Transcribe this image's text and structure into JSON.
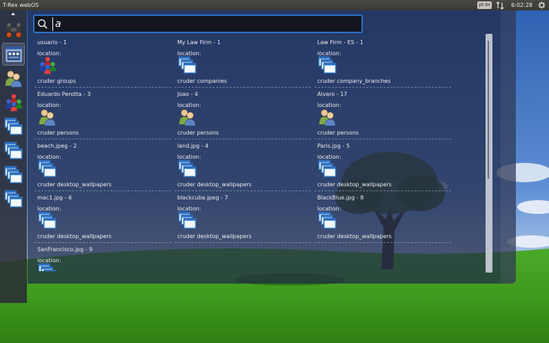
{
  "topbar": {
    "title": "T-Rex webOS",
    "language": "pt-br",
    "clock": "6:02:28"
  },
  "launcher": {
    "items": [
      {
        "name": "binoculars",
        "icon": "binoculars-icon",
        "active": false
      },
      {
        "name": "dash",
        "icon": "dash-window-icon",
        "active": true
      },
      {
        "name": "persons",
        "icon": "persons-icon",
        "active": false
      },
      {
        "name": "groups",
        "icon": "groups-icon",
        "active": false
      },
      {
        "name": "windows-1",
        "icon": "windows-icon",
        "active": false
      },
      {
        "name": "windows-2",
        "icon": "windows-icon",
        "active": false
      },
      {
        "name": "windows-3",
        "icon": "windows-icon",
        "active": false
      },
      {
        "name": "windows-4",
        "icon": "windows-icon",
        "active": false
      }
    ]
  },
  "search": {
    "value": "a",
    "placeholder": ""
  },
  "results": [
    {
      "title": "usuario - 1",
      "location_label": "location:",
      "type": "cruder groups",
      "icon": "groups-icon"
    },
    {
      "title": "My Law Firm - 1",
      "location_label": "location:",
      "type": "cruder companies",
      "icon": "windows-icon"
    },
    {
      "title": "Law Firm - ES - 1",
      "location_label": "location:",
      "type": "cruder company_branches",
      "icon": "windows-icon"
    },
    {
      "title": "Eduardo Perotta - 3",
      "location_label": "location:",
      "type": "cruder persons",
      "icon": "persons-icon"
    },
    {
      "title": "Joao - 4",
      "location_label": "location:",
      "type": "cruder persons",
      "icon": "persons-icon"
    },
    {
      "title": "Alvaro - 17",
      "location_label": "location:",
      "type": "cruder persons",
      "icon": "persons-icon"
    },
    {
      "title": "beach.jpeg - 2",
      "location_label": "location:",
      "type": "cruder desktop_wallpapers",
      "icon": "windows-icon"
    },
    {
      "title": "land.jpg - 4",
      "location_label": "location:",
      "type": "cruder desktop_wallpapers",
      "icon": "windows-icon"
    },
    {
      "title": "Paris.jpg - 5",
      "location_label": "location:",
      "type": "cruder desktop_wallpapers",
      "icon": "windows-icon"
    },
    {
      "title": "mac1.jpg - 6",
      "location_label": "location:",
      "type": "cruder desktop_wallpapers",
      "icon": "windows-icon"
    },
    {
      "title": "blackcube.jpeg - 7",
      "location_label": "location:",
      "type": "cruder desktop_wallpapers",
      "icon": "windows-icon"
    },
    {
      "title": "BlackBlue.jpg - 8",
      "location_label": "location:",
      "type": "cruder desktop_wallpapers",
      "icon": "windows-icon"
    },
    {
      "title": "SanFrancisco.jpg - 9",
      "location_label": "location:",
      "type": "",
      "icon": "windows-icon"
    }
  ],
  "colors": {
    "search_border": "#2e74c8",
    "panel": "#202846",
    "sky": "#3a5ea0",
    "grass": "#3f9a1e"
  }
}
